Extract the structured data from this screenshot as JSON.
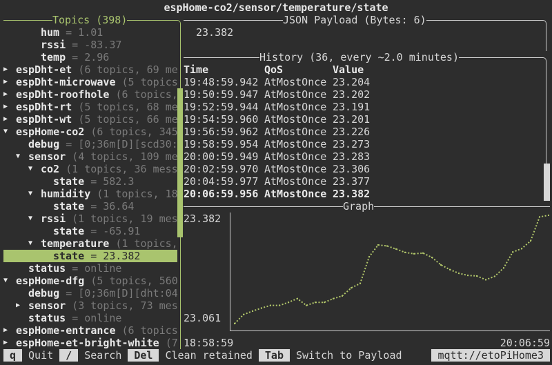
{
  "app": {
    "title": "espHome-co2/sensor/temperature/state"
  },
  "colors": {
    "background": "#2d2d2d",
    "text": "#d6d6d6",
    "muted": "#7a7a7a",
    "accent": "#a9c46e",
    "border": "#cfcfcf",
    "badge": "#d8d8d8",
    "graph_dots": "#b2c76a"
  },
  "topics": {
    "title": "Topics (398)",
    "rows": [
      {
        "depth": 2,
        "node": "leaf",
        "name": "hum",
        "detail": "= 1.01"
      },
      {
        "depth": 2,
        "node": "leaf",
        "name": "rssi",
        "detail": "= -83.37"
      },
      {
        "depth": 2,
        "node": "leaf",
        "name": "temp",
        "detail": "= 2.96"
      },
      {
        "depth": 0,
        "node": "collapsed",
        "name": "espDht-et",
        "detail": "(6 topics, 69 me"
      },
      {
        "depth": 0,
        "node": "collapsed",
        "name": "espDht-microwave",
        "detail": "(5 topics"
      },
      {
        "depth": 0,
        "node": "collapsed",
        "name": "espDht-roofhole",
        "detail": "(6 topics,"
      },
      {
        "depth": 0,
        "node": "collapsed",
        "name": "espDht-rt",
        "detail": "(5 topics, 68 me"
      },
      {
        "depth": 0,
        "node": "collapsed",
        "name": "espDht-wt",
        "detail": "(5 topics, 66 me"
      },
      {
        "depth": 0,
        "node": "expanded",
        "name": "espHome-co2",
        "detail": "(6 topics, 345"
      },
      {
        "depth": 1,
        "node": "leaf",
        "name": "debug",
        "detail": "= [0;36m[D][scd30:"
      },
      {
        "depth": 1,
        "node": "expanded",
        "name": "sensor",
        "detail": "(4 topics, 109 me"
      },
      {
        "depth": 2,
        "node": "expanded",
        "name": "co2",
        "detail": "(1 topics, 36 mess"
      },
      {
        "depth": 3,
        "node": "leaf",
        "name": "state",
        "detail": "= 582.3"
      },
      {
        "depth": 2,
        "node": "expanded",
        "name": "humidity",
        "detail": "(1 topics, 18"
      },
      {
        "depth": 3,
        "node": "leaf",
        "name": "state",
        "detail": "= 36.64"
      },
      {
        "depth": 2,
        "node": "expanded",
        "name": "rssi",
        "detail": "(1 topics, 19 mes"
      },
      {
        "depth": 3,
        "node": "leaf",
        "name": "state",
        "detail": "= -65.91"
      },
      {
        "depth": 2,
        "node": "expanded",
        "name": "temperature",
        "detail": "(1 topics,"
      },
      {
        "depth": 3,
        "node": "leaf",
        "name": "state",
        "detail": "= 23.382",
        "selected": true
      },
      {
        "depth": 1,
        "node": "leaf",
        "name": "status",
        "detail": "= online"
      },
      {
        "depth": 0,
        "node": "expanded",
        "name": "espHome-dfg",
        "detail": "(5 topics, 560"
      },
      {
        "depth": 1,
        "node": "leaf",
        "name": "debug",
        "detail": "= [0;36m[D][dht:04"
      },
      {
        "depth": 1,
        "node": "collapsed",
        "name": "sensor",
        "detail": "(3 topics, 73 mes"
      },
      {
        "depth": 1,
        "node": "leaf",
        "name": "status",
        "detail": "= online"
      },
      {
        "depth": 0,
        "node": "collapsed",
        "name": "espHome-entrance",
        "detail": "(6 topics"
      },
      {
        "depth": 0,
        "node": "collapsed",
        "name": "espHome-et-bright-white",
        "detail": "(7"
      }
    ]
  },
  "payload": {
    "title": "JSON Payload (Bytes: 6)",
    "value": "23.382"
  },
  "history": {
    "title": "History (36, every ~2.0 minutes)",
    "columns": {
      "time": "Time",
      "qos": "QoS",
      "value": "Value"
    },
    "rows": [
      {
        "time": "19:48:59.942",
        "qos": "AtMostOnce",
        "value": "23.204"
      },
      {
        "time": "19:50:59.947",
        "qos": "AtMostOnce",
        "value": "23.202"
      },
      {
        "time": "19:52:59.944",
        "qos": "AtMostOnce",
        "value": "23.191"
      },
      {
        "time": "19:54:59.960",
        "qos": "AtMostOnce",
        "value": "23.201"
      },
      {
        "time": "19:56:59.962",
        "qos": "AtMostOnce",
        "value": "23.226"
      },
      {
        "time": "19:58:59.954",
        "qos": "AtMostOnce",
        "value": "23.273"
      },
      {
        "time": "20:00:59.949",
        "qos": "AtMostOnce",
        "value": "23.283"
      },
      {
        "time": "20:02:59.970",
        "qos": "AtMostOnce",
        "value": "23.306"
      },
      {
        "time": "20:04:59.977",
        "qos": "AtMostOnce",
        "value": "23.377"
      },
      {
        "time": "20:06:59.956",
        "qos": "AtMostOnce",
        "value": "23.382",
        "latest": true
      }
    ]
  },
  "graph": {
    "title": "Graph"
  },
  "chart_data": {
    "type": "line",
    "title": "Graph",
    "xlabel": "",
    "ylabel": "",
    "x_tick_labels": [
      "18:58:59",
      "20:06:59"
    ],
    "y_tick_labels": [
      "23.382",
      "23.061"
    ],
    "ylim": [
      23.061,
      23.382
    ],
    "grid": false,
    "legend": "none",
    "series": [
      {
        "name": "espHome-co2/sensor/temperature/state",
        "values": [
          23.061,
          23.088,
          23.098,
          23.107,
          23.115,
          23.115,
          23.124,
          23.135,
          23.115,
          23.124,
          23.124,
          23.135,
          23.143,
          23.167,
          23.18,
          23.259,
          23.294,
          23.291,
          23.282,
          23.272,
          23.268,
          23.27,
          23.257,
          23.235,
          23.221,
          23.21,
          23.204,
          23.202,
          23.191,
          23.201,
          23.226,
          23.273,
          23.283,
          23.306,
          23.377,
          23.382
        ]
      }
    ]
  },
  "statusbar": {
    "keys": [
      {
        "key": "q",
        "label": "Quit"
      },
      {
        "key": "/",
        "label": "Search"
      },
      {
        "key": "Del",
        "label": "Clean retained"
      },
      {
        "key": "Tab",
        "label": "Switch to Payload"
      }
    ],
    "connection": "mqtt://etoPiHome3"
  }
}
